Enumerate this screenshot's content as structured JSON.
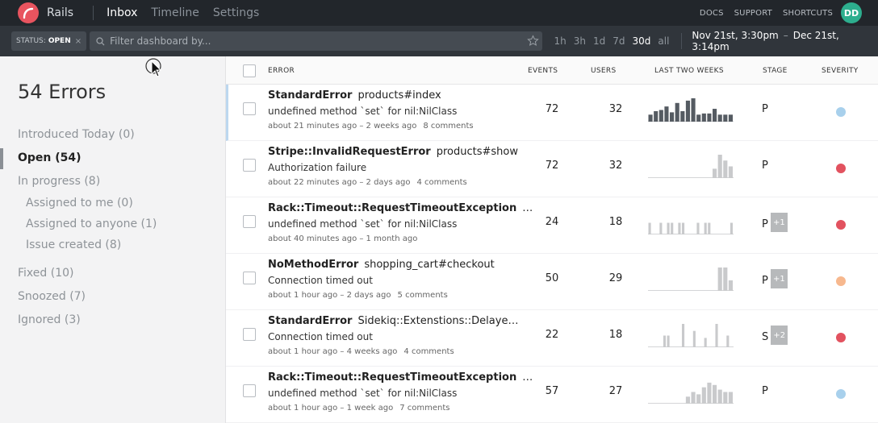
{
  "app": {
    "name": "Rails",
    "avatar": "DD"
  },
  "nav": {
    "tabs": [
      {
        "label": "Inbox",
        "active": true
      },
      {
        "label": "Timeline",
        "active": false
      },
      {
        "label": "Settings",
        "active": false
      }
    ],
    "right_links": [
      "DOCS",
      "SUPPORT",
      "SHORTCUTS"
    ]
  },
  "filter": {
    "status_key": "STATUS:",
    "status_value": "OPEN",
    "status_remove": "×",
    "search_placeholder": "Filter dashboard by...",
    "ranges": [
      {
        "label": "1h",
        "active": false
      },
      {
        "label": "3h",
        "active": false
      },
      {
        "label": "1d",
        "active": false
      },
      {
        "label": "7d",
        "active": false
      },
      {
        "label": "30d",
        "active": true
      },
      {
        "label": "all",
        "active": false
      }
    ],
    "date_from": "Nov 21st, 3:30pm",
    "date_sep": "–",
    "date_to": "Dec 21st, 3:14pm"
  },
  "sidebar": {
    "title": "54 Errors",
    "items": [
      {
        "label": "Introduced Today (0)"
      },
      {
        "label": "Open (54)",
        "active": true
      },
      {
        "label": "In progress (8)"
      },
      {
        "label": "Assigned to me (0)"
      },
      {
        "label": "Assigned to anyone (1)"
      },
      {
        "label": "Issue created (8)"
      },
      {
        "label": "Fixed (10)"
      },
      {
        "label": "Snoozed (7)"
      },
      {
        "label": "Ignored (3)"
      }
    ]
  },
  "table": {
    "headers": {
      "error": "ERROR",
      "events": "EVENTS",
      "users": "USERS",
      "trend": "LAST TWO WEEKS",
      "stage": "STAGE",
      "severity": "SEVERITY"
    },
    "rows": [
      {
        "cls": "StandardError",
        "action": "products#index",
        "message": "undefined method `set` for nil:NilClass",
        "time": "about 21 minutes ago – 2 weeks ago",
        "comments": "8 comments",
        "events": "72",
        "users": "32",
        "stage": "P",
        "extra": "",
        "severity_color": "#a8d0ec",
        "spark_color": "#555b62",
        "trend": [
          0.3,
          0.45,
          0.5,
          0.65,
          0.4,
          0.8,
          0.45,
          0.9,
          1.0,
          0.3,
          0.35,
          0.35,
          0.55,
          0.3,
          0.3,
          0.3
        ]
      },
      {
        "cls": "Stripe::InvalidRequestError",
        "action": "products#show",
        "message": "Authorization failure",
        "time": "about 22 minutes ago – 2 days ago",
        "comments": "4 comments",
        "events": "72",
        "users": "32",
        "stage": "P",
        "extra": "",
        "severity_color": "#e2525f",
        "spark_color": "#c9cacc",
        "trend": [
          0,
          0,
          0,
          0,
          0,
          0,
          0,
          0,
          0,
          0,
          0,
          0,
          0.4,
          1.0,
          0.75,
          0.5
        ]
      },
      {
        "cls": "Rack::Timeout::RequestTimeoutException",
        "action": "…",
        "message": "undefined method `set` for nil:NilClass",
        "time": "about 40 minutes ago – 1 month ago",
        "comments": "",
        "events": "24",
        "users": "18",
        "stage": "P",
        "extra": "+1",
        "severity_color": "#e2525f",
        "spark_color": "#c9cacc",
        "trend": [
          0.5,
          0,
          0,
          0.5,
          0,
          0.5,
          0.5,
          0,
          0.5,
          0.5,
          0,
          0,
          0,
          0.5,
          0,
          0.5,
          0.5,
          0,
          0,
          0,
          0,
          0,
          0.5
        ]
      },
      {
        "cls": "NoMethodError",
        "action": "shopping_cart#checkout",
        "message": "Connection timed out",
        "time": "about 1 hour ago – 2 days ago",
        "comments": "5 comments",
        "events": "50",
        "users": "29",
        "stage": "P",
        "extra": "+1",
        "severity_color": "#f7b88e",
        "spark_color": "#c9cacc",
        "trend": [
          0,
          0,
          0,
          0,
          0,
          0,
          0,
          0,
          0,
          0,
          0,
          0,
          0,
          1.0,
          1.0,
          0.45
        ]
      },
      {
        "cls": "StandardError",
        "action": "Sidekiq::Extenstions::Delaye…",
        "message": "Connection timed out",
        "time": "about 1 hour ago – 4 weeks ago",
        "comments": "4 comments",
        "events": "22",
        "users": "18",
        "stage": "S",
        "extra": "+2",
        "severity_color": "#e2525f",
        "spark_color": "#c9cacc",
        "trend": [
          0,
          0,
          0,
          0,
          0.5,
          0.5,
          0,
          0,
          0,
          1.0,
          0,
          0,
          0.7,
          0,
          0,
          0.4,
          0,
          0,
          1.0,
          0,
          0,
          0.5,
          0
        ]
      },
      {
        "cls": "Rack::Timeout::RequestTimeoutException",
        "action": "…",
        "message": "undefined method `set` for nil:NilClass",
        "time": "about 1 hour ago – 1 week ago",
        "comments": "7 comments",
        "events": "57",
        "users": "27",
        "stage": "P",
        "extra": "",
        "severity_color": "#a8d0ec",
        "spark_color": "#c9cacc",
        "trend": [
          0,
          0,
          0,
          0,
          0,
          0,
          0,
          0.3,
          0.5,
          0.4,
          0.7,
          0.9,
          0.8,
          0.6,
          0.5,
          0.5
        ]
      }
    ]
  }
}
